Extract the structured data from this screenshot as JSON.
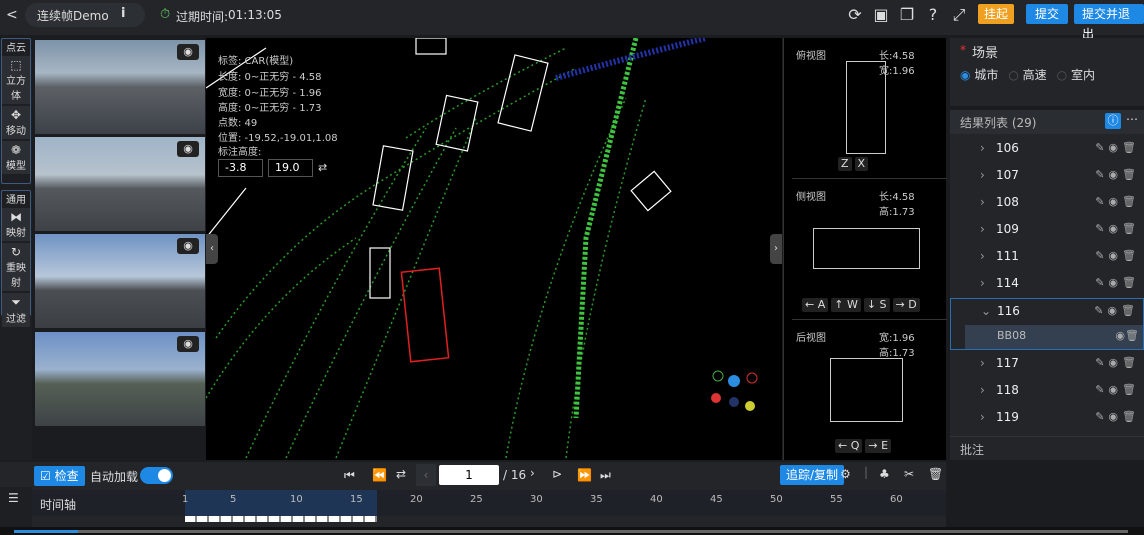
{
  "header": {
    "back_icon": "chevron-left",
    "project": "连续帧Demo",
    "info_icon": "info",
    "timer_label": "过期时间:",
    "timer_value": "01:13:05",
    "icons": [
      "share-icon",
      "save-icon",
      "copy-icon",
      "help-icon",
      "fullscreen-icon"
    ],
    "buttons": {
      "suspend": "挂起",
      "submit": "提交",
      "submit_exit": "提交并退出"
    },
    "colors": {
      "suspend": "#f0a020",
      "primary": "#1e88e5"
    }
  },
  "tools": {
    "pointcloud": "点云",
    "cube": "立方体",
    "move": "移动",
    "model": "模型",
    "general": "通用",
    "map": "映射",
    "remap": "重映射",
    "filter": "过滤"
  },
  "info": {
    "tag": "标签: CAR(模型)",
    "length": "长度: 0~正无穷 - 4.58",
    "width": "宽度: 0~正无穷 - 1.96",
    "height": "高度: 0~正无穷 - 1.73",
    "points": "点数: 49",
    "position": "位置: -19.52,-19.01,1.08",
    "annot_height": "标注高度:",
    "min": "-3.8",
    "max": "19.0"
  },
  "sideviews": {
    "top": {
      "title": "俯视图",
      "dims": "长:4.58 宽:1.96",
      "keys": [
        "Z",
        "X"
      ]
    },
    "side": {
      "title": "侧视图",
      "dims": "长:4.58 高:1.73",
      "keys": [
        "← A",
        "↑ W",
        "↓ S",
        "→ D"
      ]
    },
    "back": {
      "title": "后视图",
      "dims": "宽:1.96 高:1.73",
      "keys": [
        "← Q",
        "→ E"
      ]
    }
  },
  "scene": {
    "title": "场景",
    "options": [
      "城市",
      "高速",
      "室内"
    ],
    "selected": "城市"
  },
  "results": {
    "title": "结果列表 (29)",
    "items": [
      "106",
      "107",
      "108",
      "109",
      "111",
      "114",
      "116",
      "117",
      "118",
      "119"
    ],
    "expanded": "116",
    "child": "BB08"
  },
  "notes": {
    "title": "批注"
  },
  "bottom": {
    "check": "检查",
    "autoload": "自动加载",
    "autoload_on": true,
    "page": "1",
    "total": "/ 16",
    "track": "追踪/复制",
    "timeline": "时间轴",
    "ticks": [
      "1",
      "5",
      "10",
      "15",
      "20",
      "25",
      "30",
      "35",
      "40",
      "45",
      "50",
      "55",
      "60"
    ],
    "current_frame": 1,
    "loaded_frames": 16
  }
}
